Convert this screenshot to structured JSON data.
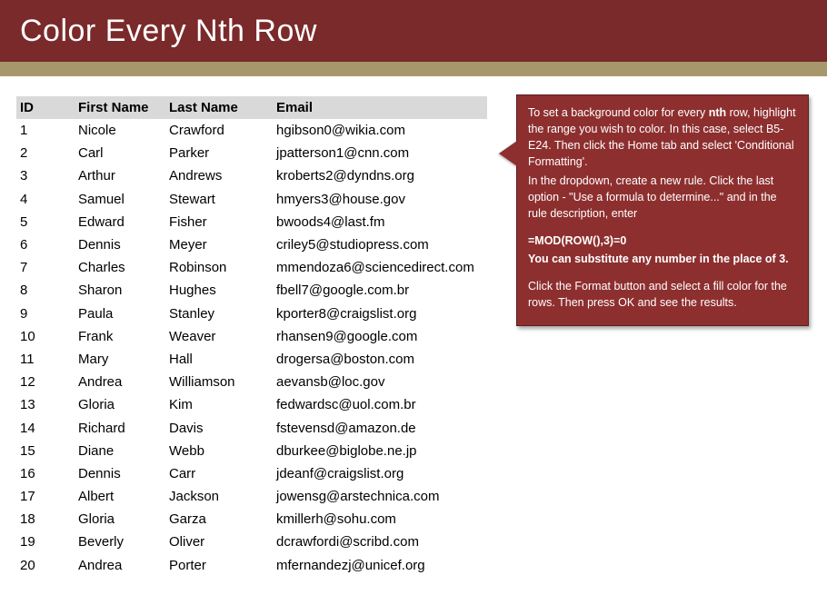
{
  "header": {
    "title": "Color Every Nth Row"
  },
  "table": {
    "headers": {
      "id": "ID",
      "first": "First Name",
      "last": "Last Name",
      "email": "Email"
    },
    "rows": [
      {
        "id": "1",
        "first": "Nicole",
        "last": "Crawford",
        "email": "hgibson0@wikia.com"
      },
      {
        "id": "2",
        "first": "Carl",
        "last": "Parker",
        "email": "jpatterson1@cnn.com"
      },
      {
        "id": "3",
        "first": "Arthur",
        "last": "Andrews",
        "email": "kroberts2@dyndns.org"
      },
      {
        "id": "4",
        "first": "Samuel",
        "last": "Stewart",
        "email": "hmyers3@house.gov"
      },
      {
        "id": "5",
        "first": "Edward",
        "last": "Fisher",
        "email": "bwoods4@last.fm"
      },
      {
        "id": "6",
        "first": "Dennis",
        "last": "Meyer",
        "email": "criley5@studiopress.com"
      },
      {
        "id": "7",
        "first": "Charles",
        "last": "Robinson",
        "email": "mmendoza6@sciencedirect.com"
      },
      {
        "id": "8",
        "first": "Sharon",
        "last": "Hughes",
        "email": "fbell7@google.com.br"
      },
      {
        "id": "9",
        "first": "Paula",
        "last": "Stanley",
        "email": "kporter8@craigslist.org"
      },
      {
        "id": "10",
        "first": "Frank",
        "last": "Weaver",
        "email": "rhansen9@google.com"
      },
      {
        "id": "11",
        "first": "Mary",
        "last": "Hall",
        "email": "drogersa@boston.com"
      },
      {
        "id": "12",
        "first": "Andrea",
        "last": "Williamson",
        "email": "aevansb@loc.gov"
      },
      {
        "id": "13",
        "first": "Gloria",
        "last": "Kim",
        "email": "fedwardsc@uol.com.br"
      },
      {
        "id": "14",
        "first": "Richard",
        "last": "Davis",
        "email": "fstevensd@amazon.de"
      },
      {
        "id": "15",
        "first": "Diane",
        "last": "Webb",
        "email": "dburkee@biglobe.ne.jp"
      },
      {
        "id": "16",
        "first": "Dennis",
        "last": "Carr",
        "email": "jdeanf@craigslist.org"
      },
      {
        "id": "17",
        "first": "Albert",
        "last": "Jackson",
        "email": "jowensg@arstechnica.com"
      },
      {
        "id": "18",
        "first": "Gloria",
        "last": "Garza",
        "email": "kmillerh@sohu.com"
      },
      {
        "id": "19",
        "first": "Beverly",
        "last": "Oliver",
        "email": "dcrawfordi@scribd.com"
      },
      {
        "id": "20",
        "first": "Andrea",
        "last": "Porter",
        "email": "mfernandezj@unicef.org"
      }
    ]
  },
  "callout": {
    "p1a": "To set a background color for every ",
    "p1b": "nth",
    "p1c": " row, highlight the range you wish to color. In this case, select B5-E24. Then click the Home tab and select 'Conditional Formatting'.",
    "p2": "In the dropdown, create a new rule. Click the last option - \"Use a formula to determine...\" and in the rule description, enter",
    "formula": "=MOD(ROW(),3)=0",
    "subnote": "You can substitute any number in the place of 3.",
    "p3": "Click the Format button and select a fill color for the rows. Then press OK and see the results."
  }
}
